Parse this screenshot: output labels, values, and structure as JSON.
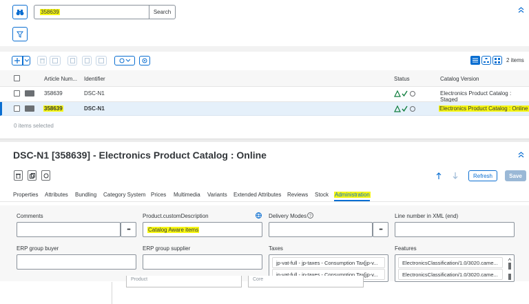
{
  "search": {
    "value": "358639",
    "button": "Search"
  },
  "toolbar": {
    "items_count": "2 items"
  },
  "table": {
    "headers": {
      "article_number": "Article Num...",
      "identifier": "Identifier",
      "status": "Status",
      "catalog_version": "Catalog Version"
    },
    "rows": [
      {
        "article": "358639",
        "identifier": "DSC-N1",
        "catalog": "Electronics Product Catalog : Staged"
      },
      {
        "article": "358639",
        "identifier": "DSC-N1",
        "catalog": "Electronics Product Catalog : Online"
      }
    ],
    "selection_status": "0 items selected"
  },
  "editor": {
    "title": "DSC-N1 [358639] - Electronics Product Catalog : Online",
    "refresh": "Refresh",
    "save": "Save",
    "tabs": [
      "Properties",
      "Attributes",
      "Bundling",
      "Category System",
      "Prices",
      "Multimedia",
      "Variants",
      "Extended Attributes",
      "Reviews",
      "Stock",
      "Administration"
    ],
    "active_tab": "Administration"
  },
  "form": {
    "comments_label": "Comments",
    "custom_desc_label": "Product.customDescription",
    "custom_desc_value": "Catalog Aware items",
    "delivery_label": "Delivery Modes",
    "line_label": "Line number in XML (end)",
    "erp_buyer_label": "ERP group buyer",
    "erp_supplier_label": "ERP group supplier",
    "taxes_label": "Taxes",
    "taxes_values": [
      "jp-vat-full - jp-taxes - Consumption Tax[jp-v...",
      "jp-vat-full - jp-taxes - Consumption Tax[jp-v..."
    ],
    "features_label": "Features",
    "features_values": [
      "ElectronicsClassification/1.0/3020.came...",
      "ElectronicsClassification/1.0/3020.came..."
    ],
    "more_button": "•••",
    "ghost_product": "Product",
    "ghost_core": "Core"
  },
  "colors": {
    "accent": "#0a6ed1",
    "highlight": "#f7f712",
    "selected_row": "#e5f0fa",
    "status_green": "#107e3e"
  }
}
